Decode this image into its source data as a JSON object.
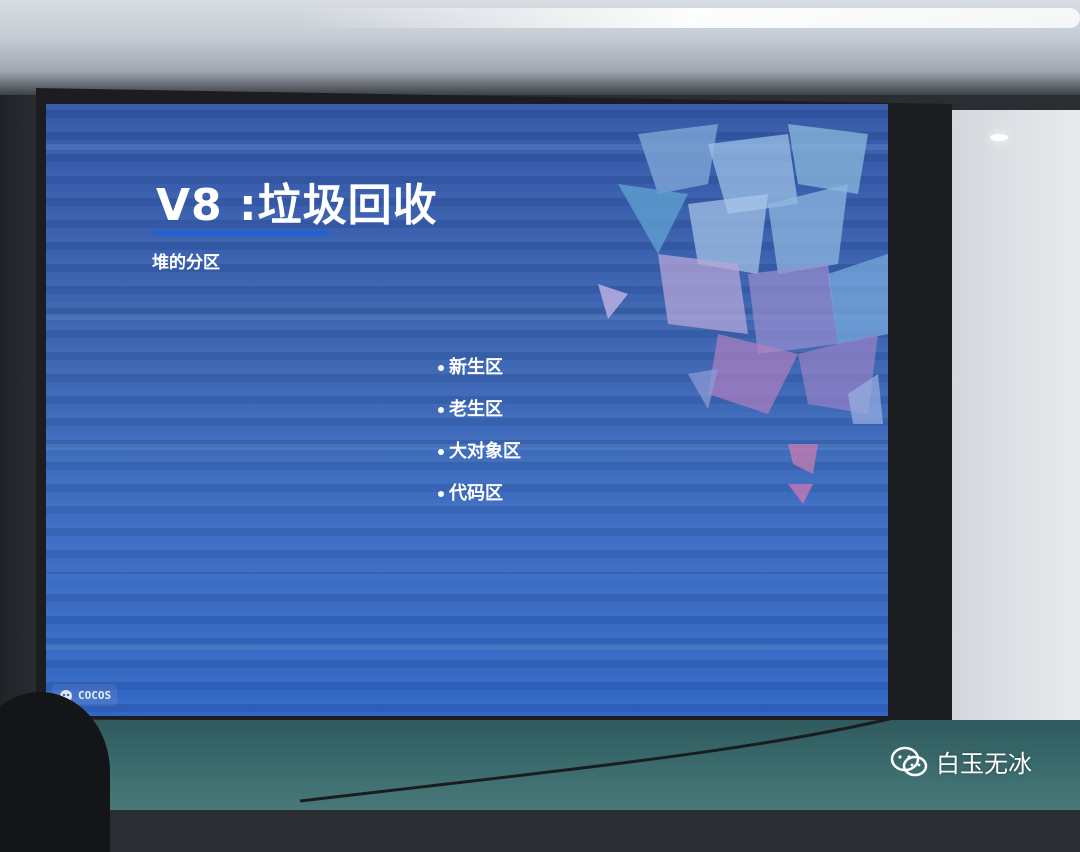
{
  "slide": {
    "title": "V8 :垃圾回收",
    "subtitle": "堆的分区",
    "bullets": [
      "新生区",
      "老生区",
      "大对象区",
      "代码区"
    ],
    "logo_text": "COCOS"
  },
  "watermark": {
    "text": "白玉无冰",
    "icon": "wechat-icon"
  },
  "colors": {
    "slide_background": "#3a64b2",
    "title_underline": "#1f5fe0",
    "text": "#ffffff"
  }
}
